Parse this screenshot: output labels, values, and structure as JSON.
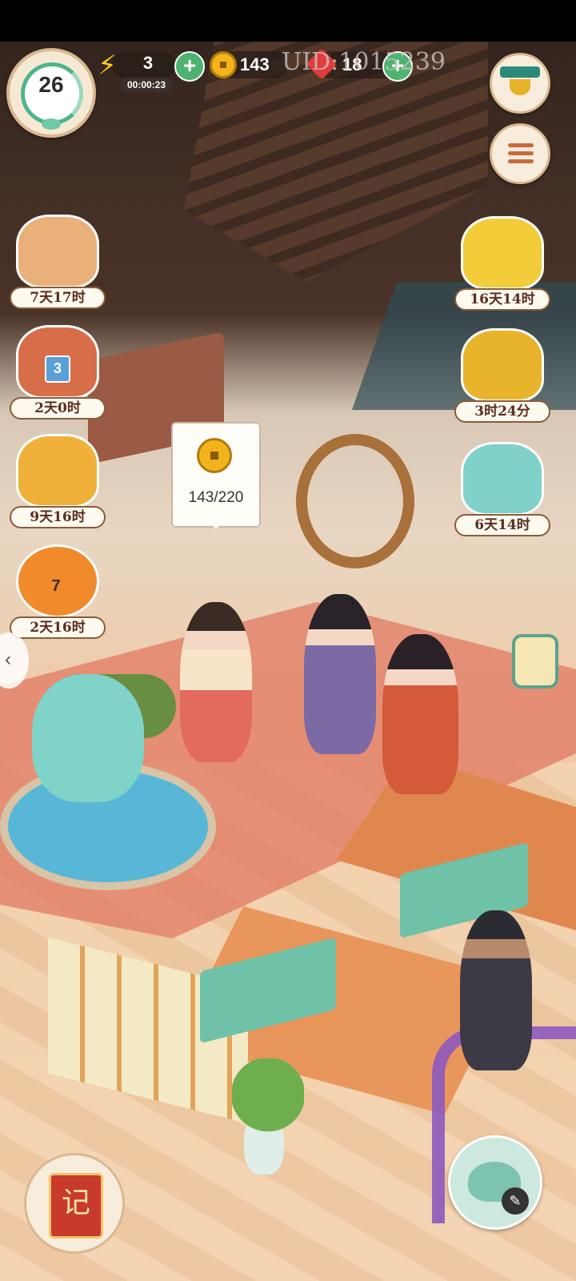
{
  "hud": {
    "level": "26",
    "energy": "3",
    "energy_timer": "00:00:23",
    "coins": "143",
    "uid_label": "UID:1015239",
    "gems": "18",
    "plus_symbol": "+"
  },
  "left_events": [
    {
      "name": "scroll-event",
      "timer": "7天17时",
      "color": "#e9b07a"
    },
    {
      "name": "chest-event",
      "timer": "2天0时",
      "badge": "3",
      "color": "#d86d4a"
    },
    {
      "name": "wheat-event",
      "timer": "9天16时",
      "color": "#f0b13a"
    },
    {
      "name": "pumpkin-event",
      "timer": "2天16时",
      "badge": "7",
      "color": "#f08a2a"
    }
  ],
  "right_events": [
    {
      "name": "chrysanthemum-event",
      "timer": "16天14时",
      "color": "#f3cc3a"
    },
    {
      "name": "gold-box-event",
      "timer": "3时24分",
      "color": "#e8b42c"
    },
    {
      "name": "gift-box-event",
      "timer": "6天14时",
      "color": "#7fd1c9"
    }
  ],
  "coin_bubble": {
    "text": "143/220"
  },
  "book_glyph": "记",
  "teapot_pen": "✎",
  "arrow_glyph": "‹",
  "colors": {
    "accent_green": "#4db36e",
    "coin_gold": "#f2b31c",
    "timer_text": "#5a2e1e"
  }
}
